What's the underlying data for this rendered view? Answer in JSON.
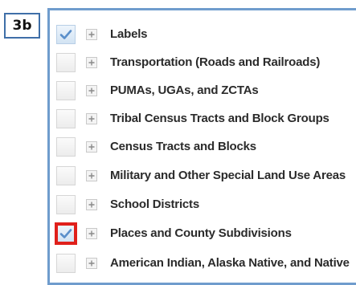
{
  "step_label": "3b",
  "layers": [
    {
      "label": "Labels",
      "checked": true,
      "highlighted": false
    },
    {
      "label": "Transportation (Roads and Railroads)",
      "checked": false,
      "highlighted": false
    },
    {
      "label": "PUMAs, UGAs, and ZCTAs",
      "checked": false,
      "highlighted": false
    },
    {
      "label": "Tribal Census Tracts and Block Groups",
      "checked": false,
      "highlighted": false
    },
    {
      "label": "Census Tracts and Blocks",
      "checked": false,
      "highlighted": false
    },
    {
      "label": "Military and Other Special Land Use Areas",
      "checked": false,
      "highlighted": false
    },
    {
      "label": "School Districts",
      "checked": false,
      "highlighted": false
    },
    {
      "label": "Places and County Subdivisions",
      "checked": true,
      "highlighted": true
    },
    {
      "label": "American Indian, Alaska Native, and Native",
      "checked": false,
      "highlighted": false
    }
  ],
  "colors": {
    "panel_border": "#6f9ccd",
    "highlight": "#e0201b",
    "checkmark": "#5b8fca"
  }
}
